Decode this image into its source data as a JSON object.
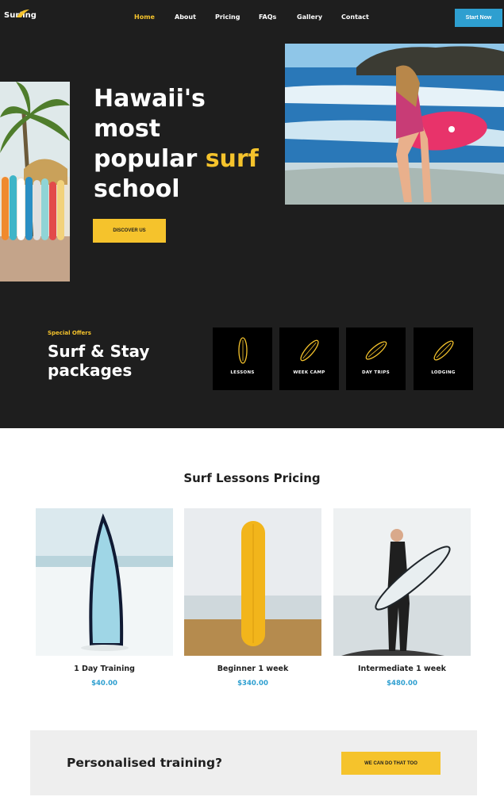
{
  "brand": {
    "logo_text": "Surfing"
  },
  "nav": {
    "items": [
      {
        "label": "Home",
        "active": true
      },
      {
        "label": "About"
      },
      {
        "label": "Pricing"
      },
      {
        "label": "FAQs"
      },
      {
        "label": "Gallery"
      },
      {
        "label": "Contact"
      }
    ],
    "cta_label": "Start Now"
  },
  "hero": {
    "title_line1": "Hawaii's",
    "title_line2": "most",
    "title_line3_prefix": "popular",
    "title_highlight": "surf",
    "title_line4": "school",
    "button_label": "DISCOVER US"
  },
  "offers": {
    "eyebrow": "Special Offers",
    "title_line1": "Surf & Stay",
    "title_line2": "packages",
    "tiles": [
      {
        "label": "LESSONS",
        "icon": "surfboard-icon"
      },
      {
        "label": "WEEK CAMP",
        "icon": "surfboard-icon"
      },
      {
        "label": "DAY TRIPS",
        "icon": "surfboard-icon"
      },
      {
        "label": "LODGING",
        "icon": "surfboard-icon"
      }
    ]
  },
  "pricing": {
    "title": "Surf Lessons Pricing",
    "cards": [
      {
        "name": "1 Day Training",
        "price": "$40.00"
      },
      {
        "name": "Beginner 1 week",
        "price": "$340.00"
      },
      {
        "name": "Intermediate 1 week",
        "price": "$480.00"
      }
    ]
  },
  "personal": {
    "text": "Personalised training?",
    "button_label": "WE CAN DO THAT TOO"
  },
  "colors": {
    "accent": "#f5c32c",
    "blue": "#2e9fd0",
    "dark": "#1e1e1e"
  }
}
